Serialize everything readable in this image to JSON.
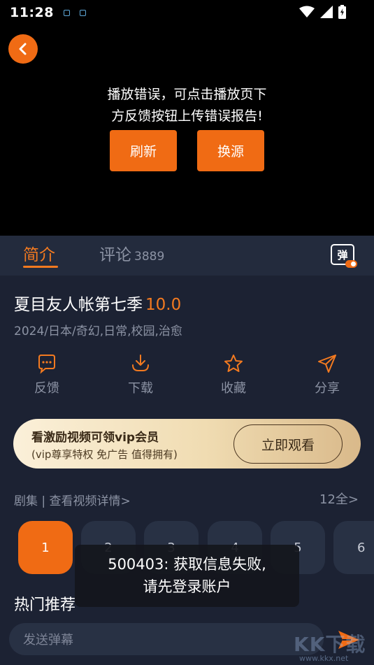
{
  "status_bar": {
    "time": "11:28"
  },
  "player": {
    "error_line1": "播放错误，可点击播放页下",
    "error_line2": "方反馈按钮上传错误报告!",
    "refresh_label": "刷新",
    "switch_source_label": "换源"
  },
  "tabs": {
    "intro": "简介",
    "comments": "评论",
    "comments_count": "3889",
    "danmu_label": "弹"
  },
  "show": {
    "title": "夏目友人帐第七季",
    "rating": "10.0",
    "meta": "2024/日本/奇幻,日常,校园,治愈"
  },
  "actions": [
    {
      "label": "反馈",
      "icon": "feedback-icon"
    },
    {
      "label": "下载",
      "icon": "download-icon"
    },
    {
      "label": "收藏",
      "icon": "star-icon"
    },
    {
      "label": "分享",
      "icon": "share-icon"
    }
  ],
  "vip": {
    "title": "看激励视频可领vip会员",
    "subtitle": "(vip尊享特权 免广告 值得拥有)",
    "button": "立即观看"
  },
  "episodes": {
    "header": "剧集 | 查看视频详情>",
    "total": "12全>",
    "items": [
      "1",
      "2",
      "3",
      "4",
      "5",
      "6"
    ],
    "active": "1"
  },
  "hot_title": "热门推荐",
  "toast": {
    "line1": "500403: 获取信息失败,",
    "line2": "请先登录账户"
  },
  "danmu_input": {
    "placeholder": "发送弹幕"
  },
  "watermark": {
    "text": "KK下载",
    "url": "www.kkx.net"
  },
  "colors": {
    "accent": "#f06b14",
    "background": "#1c2233",
    "player_bg": "#000000"
  }
}
